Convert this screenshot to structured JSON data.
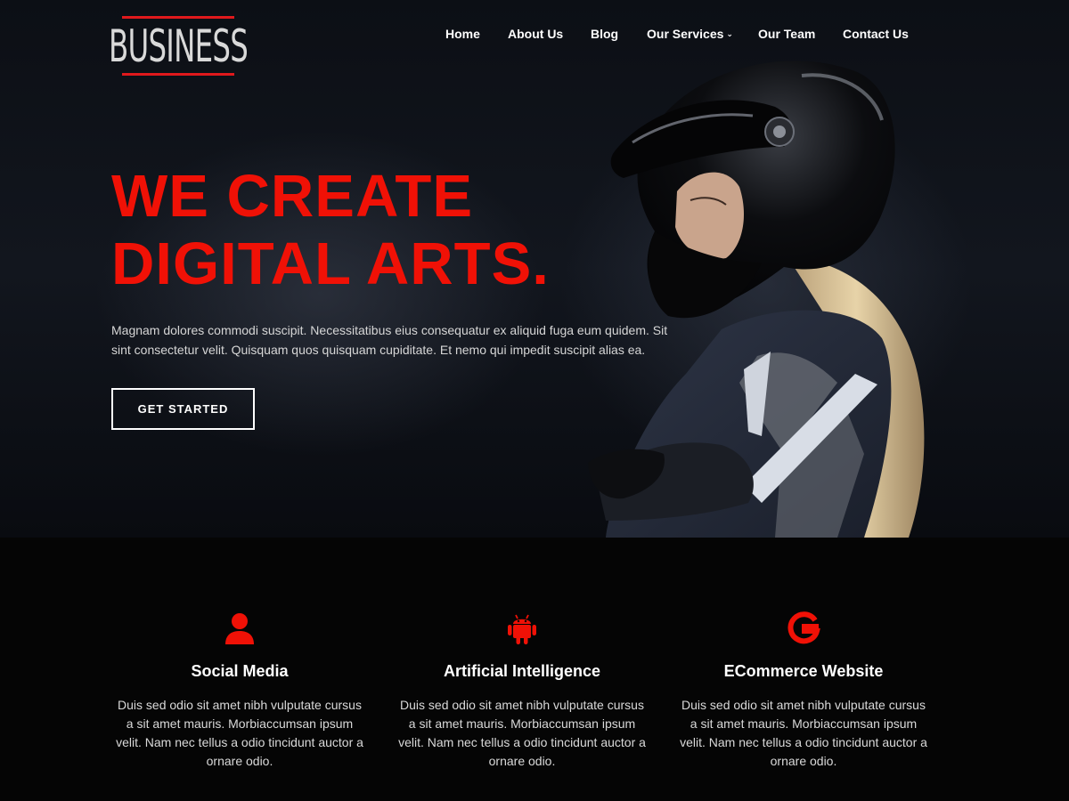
{
  "brand": {
    "logo_text": "BUSINESS"
  },
  "nav": {
    "items": [
      {
        "label": "Home"
      },
      {
        "label": "About Us"
      },
      {
        "label": "Blog"
      },
      {
        "label": "Our Services",
        "has_dropdown": true
      },
      {
        "label": "Our Team"
      },
      {
        "label": "Contact Us"
      }
    ]
  },
  "hero": {
    "title_line1": "WE CREATE",
    "title_line2": "DIGITAL ARTS.",
    "description": "Magnam dolores commodi suscipit. Necessitatibus eius consequatur ex aliquid fuga eum quidem. Sit sint consectetur velit. Quisquam quos quisquam cupiditate. Et nemo qui impedit suscipit alias ea.",
    "cta_label": "GET STARTED"
  },
  "features": [
    {
      "icon": "user-icon",
      "title": "Social Media",
      "text": "Duis sed odio sit amet nibh vulputate cursus a sit amet mauris. Morbiaccumsan ipsum velit. Nam nec tellus a odio tincidunt auctor a ornare odio."
    },
    {
      "icon": "android-icon",
      "title": "Artificial Intelligence",
      "text": "Duis sed odio sit amet nibh vulputate cursus a sit amet mauris. Morbiaccumsan ipsum velit. Nam nec tellus a odio tincidunt auctor a ornare odio."
    },
    {
      "icon": "google-icon",
      "title": "ECommerce Website",
      "text": "Duis sed odio sit amet nibh vulputate cursus a sit amet mauris. Morbiaccumsan ipsum velit. Nam nec tellus a odio tincidunt auctor a ornare odio."
    }
  ],
  "colors": {
    "accent": "#f01106",
    "logo_bar": "#e0191c",
    "hero_background": "#0d1017",
    "section_background": "#050505",
    "text_light": "#d6d6d6"
  }
}
